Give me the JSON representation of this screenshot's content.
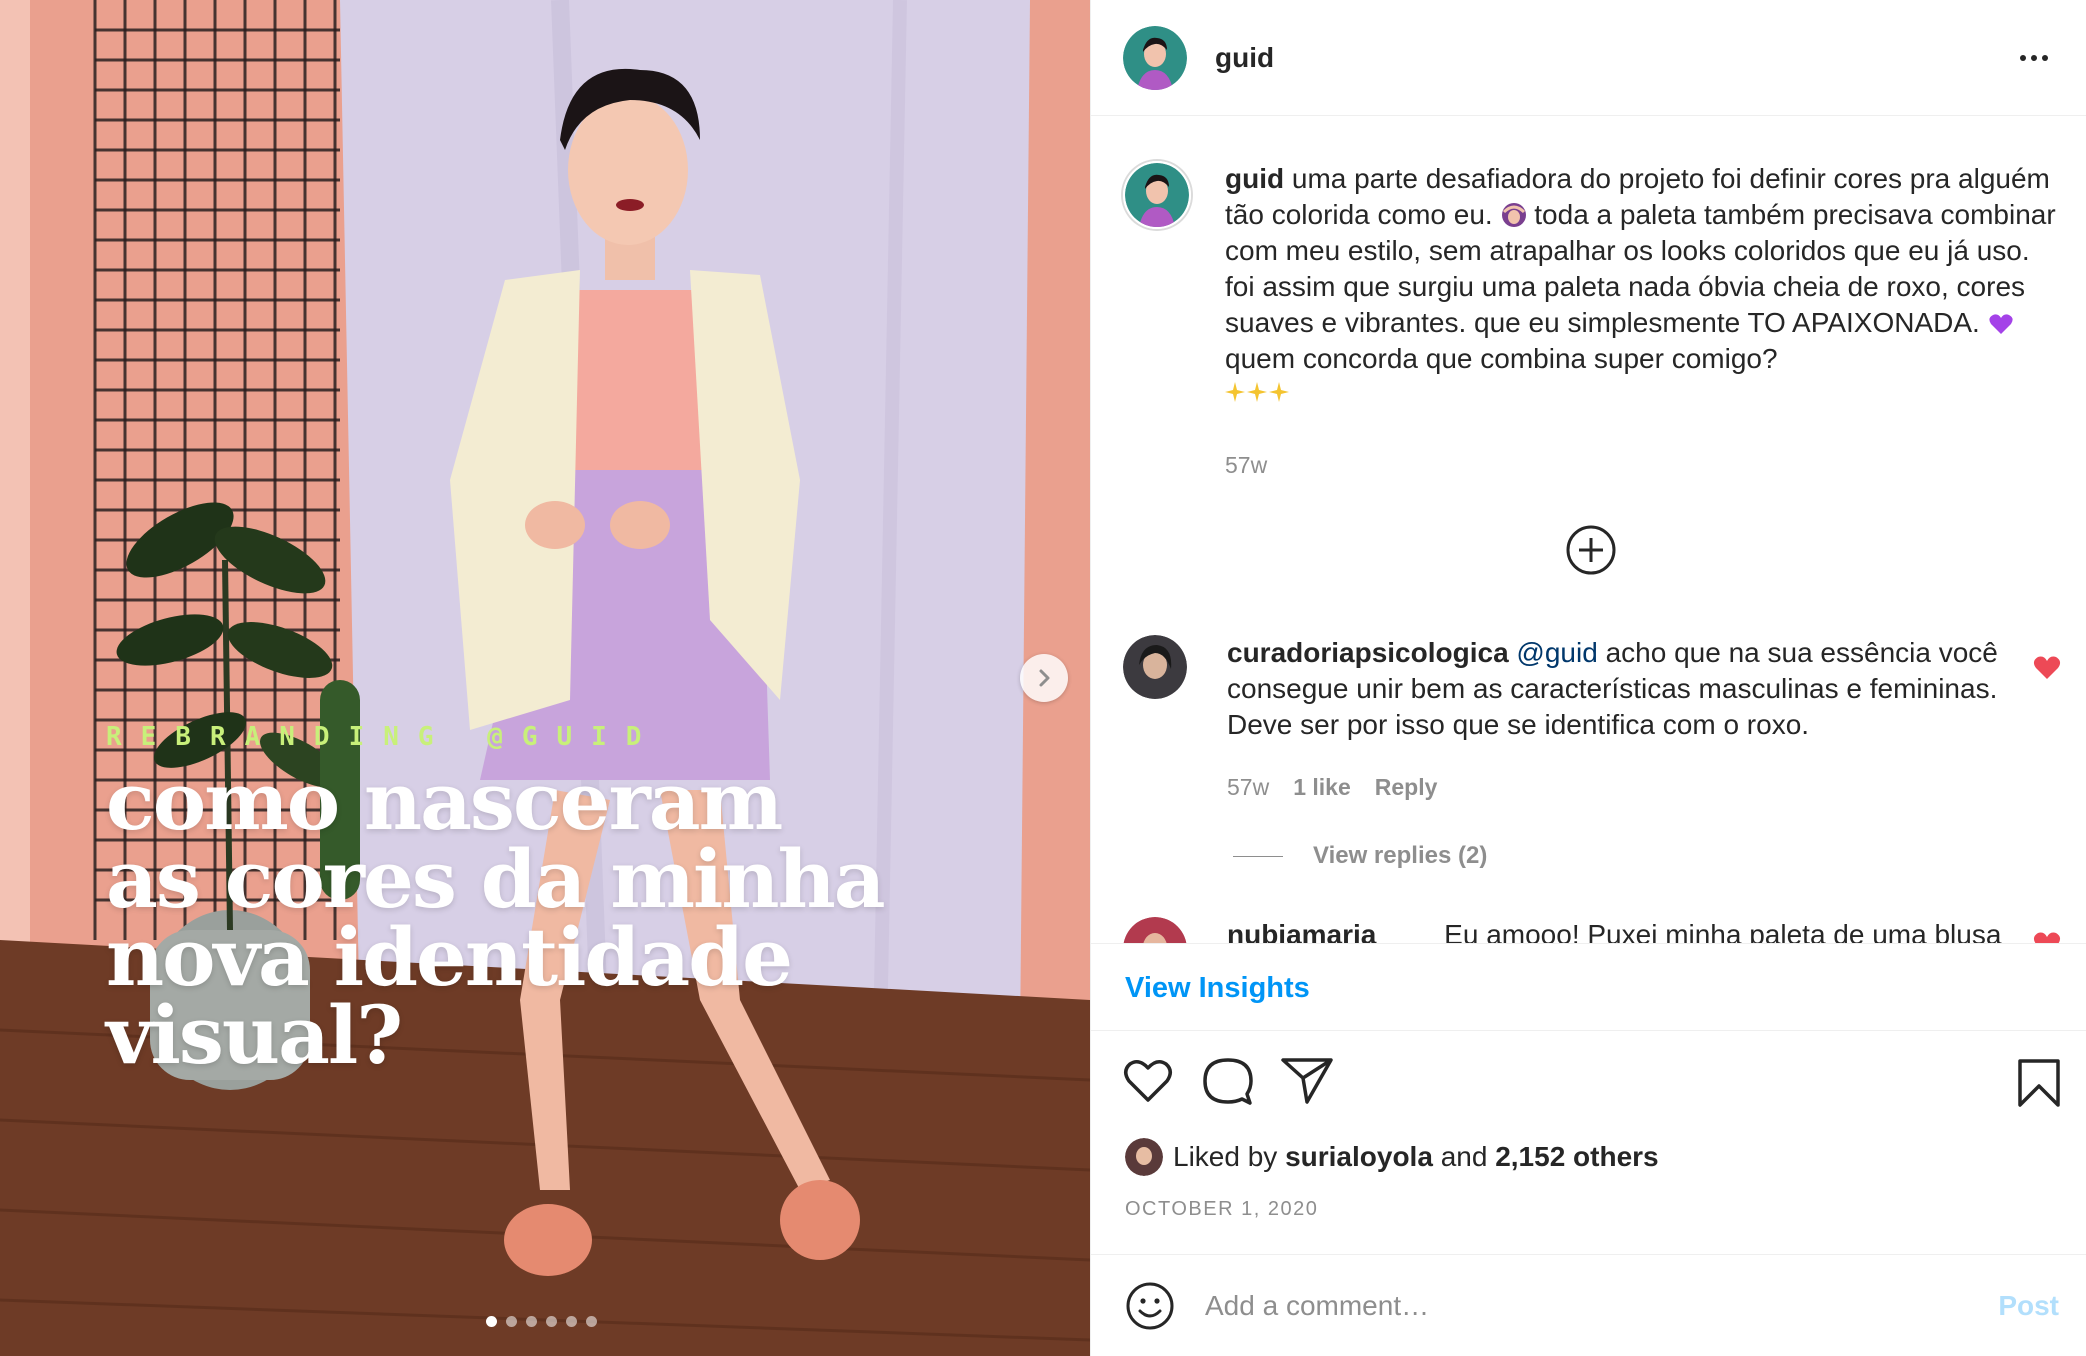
{
  "post": {
    "image_overlay": {
      "kicker": "REBRANDING @GUID",
      "headline_lines": [
        "como nasceram",
        "as cores da minha",
        "nova identidade",
        "visual?"
      ]
    },
    "carousel": {
      "slides": 6,
      "active_slide": 1
    }
  },
  "header": {
    "username": "guid",
    "more_icon": "more-horizontal-icon"
  },
  "caption": {
    "username": "guid",
    "text_part1": "uma parte desafiadora do projeto foi definir cores pra alguém tão colorida como eu.",
    "emoji1": "woman-gesturing-ok",
    "text_part2": "toda a paleta também precisava combinar com meu estilo, sem atrapalhar os looks coloridos que eu já uso. foi assim que surgiu uma paleta nada óbvia cheia de roxo, cores suaves e vibrantes. que eu simplesmente TO APAIXONADA.",
    "emoji2": "purple-heart",
    "text_part3": "quem concorda que combina super comigo?",
    "emoji3": "sparkles x3",
    "time": "57w"
  },
  "comments": [
    {
      "username": "curadoriapsicologica",
      "mention": "@guid",
      "text": "acho que na sua essência você consegue unir bem as características masculinas e femininas. Deve ser por isso que se identifica com o roxo.",
      "time": "57w",
      "likes": "1 like",
      "reply_label": "Reply",
      "liked": true,
      "view_replies": "View replies (2)"
    },
    {
      "username": "nubiamaria",
      "text": "Eu amooo! Puxei minha paleta de uma blusa",
      "liked": true
    }
  ],
  "insights": {
    "label": "View Insights"
  },
  "likes": {
    "prefix": "Liked by",
    "user": "surialoyola",
    "and": "and",
    "others": "2,152 others"
  },
  "date": "OCTOBER 1, 2020",
  "comment_box": {
    "placeholder": "Add a comment…",
    "post_label": "Post"
  },
  "colors": {
    "accent_blue": "#0095f6",
    "post_disabled": "#b2dffc",
    "heart_red": "#ed4956",
    "kicker_green": "#c8f07a"
  }
}
